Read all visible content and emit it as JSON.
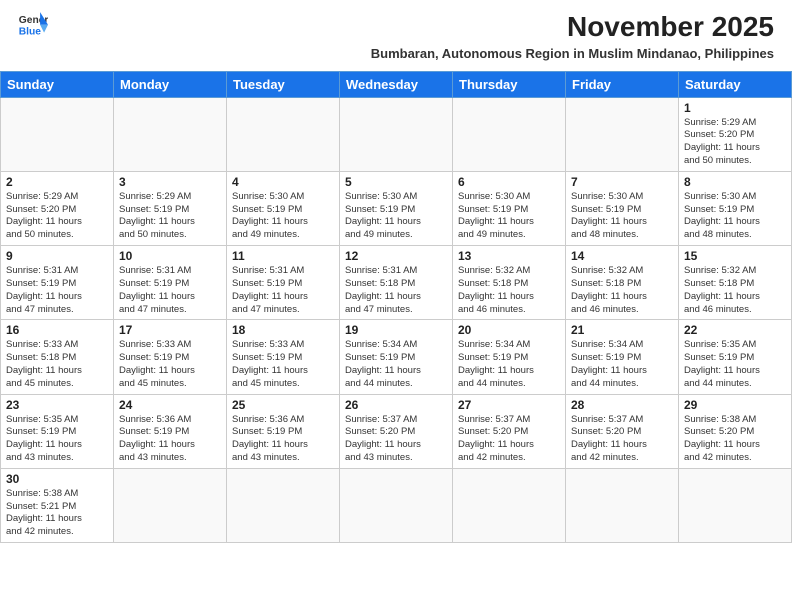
{
  "header": {
    "logo_general": "General",
    "logo_blue": "Blue",
    "month_title": "November 2025",
    "subtitle": "Bumbaran, Autonomous Region in Muslim Mindanao, Philippines"
  },
  "days_of_week": [
    "Sunday",
    "Monday",
    "Tuesday",
    "Wednesday",
    "Thursday",
    "Friday",
    "Saturday"
  ],
  "weeks": [
    [
      {
        "day": "",
        "info": ""
      },
      {
        "day": "",
        "info": ""
      },
      {
        "day": "",
        "info": ""
      },
      {
        "day": "",
        "info": ""
      },
      {
        "day": "",
        "info": ""
      },
      {
        "day": "",
        "info": ""
      },
      {
        "day": "1",
        "info": "Sunrise: 5:29 AM\nSunset: 5:20 PM\nDaylight: 11 hours\nand 50 minutes."
      }
    ],
    [
      {
        "day": "2",
        "info": "Sunrise: 5:29 AM\nSunset: 5:20 PM\nDaylight: 11 hours\nand 50 minutes."
      },
      {
        "day": "3",
        "info": "Sunrise: 5:29 AM\nSunset: 5:19 PM\nDaylight: 11 hours\nand 50 minutes."
      },
      {
        "day": "4",
        "info": "Sunrise: 5:30 AM\nSunset: 5:19 PM\nDaylight: 11 hours\nand 49 minutes."
      },
      {
        "day": "5",
        "info": "Sunrise: 5:30 AM\nSunset: 5:19 PM\nDaylight: 11 hours\nand 49 minutes."
      },
      {
        "day": "6",
        "info": "Sunrise: 5:30 AM\nSunset: 5:19 PM\nDaylight: 11 hours\nand 49 minutes."
      },
      {
        "day": "7",
        "info": "Sunrise: 5:30 AM\nSunset: 5:19 PM\nDaylight: 11 hours\nand 48 minutes."
      },
      {
        "day": "8",
        "info": "Sunrise: 5:30 AM\nSunset: 5:19 PM\nDaylight: 11 hours\nand 48 minutes."
      }
    ],
    [
      {
        "day": "9",
        "info": "Sunrise: 5:31 AM\nSunset: 5:19 PM\nDaylight: 11 hours\nand 47 minutes."
      },
      {
        "day": "10",
        "info": "Sunrise: 5:31 AM\nSunset: 5:19 PM\nDaylight: 11 hours\nand 47 minutes."
      },
      {
        "day": "11",
        "info": "Sunrise: 5:31 AM\nSunset: 5:19 PM\nDaylight: 11 hours\nand 47 minutes."
      },
      {
        "day": "12",
        "info": "Sunrise: 5:31 AM\nSunset: 5:18 PM\nDaylight: 11 hours\nand 47 minutes."
      },
      {
        "day": "13",
        "info": "Sunrise: 5:32 AM\nSunset: 5:18 PM\nDaylight: 11 hours\nand 46 minutes."
      },
      {
        "day": "14",
        "info": "Sunrise: 5:32 AM\nSunset: 5:18 PM\nDaylight: 11 hours\nand 46 minutes."
      },
      {
        "day": "15",
        "info": "Sunrise: 5:32 AM\nSunset: 5:18 PM\nDaylight: 11 hours\nand 46 minutes."
      }
    ],
    [
      {
        "day": "16",
        "info": "Sunrise: 5:33 AM\nSunset: 5:18 PM\nDaylight: 11 hours\nand 45 minutes."
      },
      {
        "day": "17",
        "info": "Sunrise: 5:33 AM\nSunset: 5:19 PM\nDaylight: 11 hours\nand 45 minutes."
      },
      {
        "day": "18",
        "info": "Sunrise: 5:33 AM\nSunset: 5:19 PM\nDaylight: 11 hours\nand 45 minutes."
      },
      {
        "day": "19",
        "info": "Sunrise: 5:34 AM\nSunset: 5:19 PM\nDaylight: 11 hours\nand 44 minutes."
      },
      {
        "day": "20",
        "info": "Sunrise: 5:34 AM\nSunset: 5:19 PM\nDaylight: 11 hours\nand 44 minutes."
      },
      {
        "day": "21",
        "info": "Sunrise: 5:34 AM\nSunset: 5:19 PM\nDaylight: 11 hours\nand 44 minutes."
      },
      {
        "day": "22",
        "info": "Sunrise: 5:35 AM\nSunset: 5:19 PM\nDaylight: 11 hours\nand 44 minutes."
      }
    ],
    [
      {
        "day": "23",
        "info": "Sunrise: 5:35 AM\nSunset: 5:19 PM\nDaylight: 11 hours\nand 43 minutes."
      },
      {
        "day": "24",
        "info": "Sunrise: 5:36 AM\nSunset: 5:19 PM\nDaylight: 11 hours\nand 43 minutes."
      },
      {
        "day": "25",
        "info": "Sunrise: 5:36 AM\nSunset: 5:19 PM\nDaylight: 11 hours\nand 43 minutes."
      },
      {
        "day": "26",
        "info": "Sunrise: 5:37 AM\nSunset: 5:20 PM\nDaylight: 11 hours\nand 43 minutes."
      },
      {
        "day": "27",
        "info": "Sunrise: 5:37 AM\nSunset: 5:20 PM\nDaylight: 11 hours\nand 42 minutes."
      },
      {
        "day": "28",
        "info": "Sunrise: 5:37 AM\nSunset: 5:20 PM\nDaylight: 11 hours\nand 42 minutes."
      },
      {
        "day": "29",
        "info": "Sunrise: 5:38 AM\nSunset: 5:20 PM\nDaylight: 11 hours\nand 42 minutes."
      }
    ],
    [
      {
        "day": "30",
        "info": "Sunrise: 5:38 AM\nSunset: 5:21 PM\nDaylight: 11 hours\nand 42 minutes."
      },
      {
        "day": "",
        "info": ""
      },
      {
        "day": "",
        "info": ""
      },
      {
        "day": "",
        "info": ""
      },
      {
        "day": "",
        "info": ""
      },
      {
        "day": "",
        "info": ""
      },
      {
        "day": "",
        "info": ""
      }
    ]
  ]
}
